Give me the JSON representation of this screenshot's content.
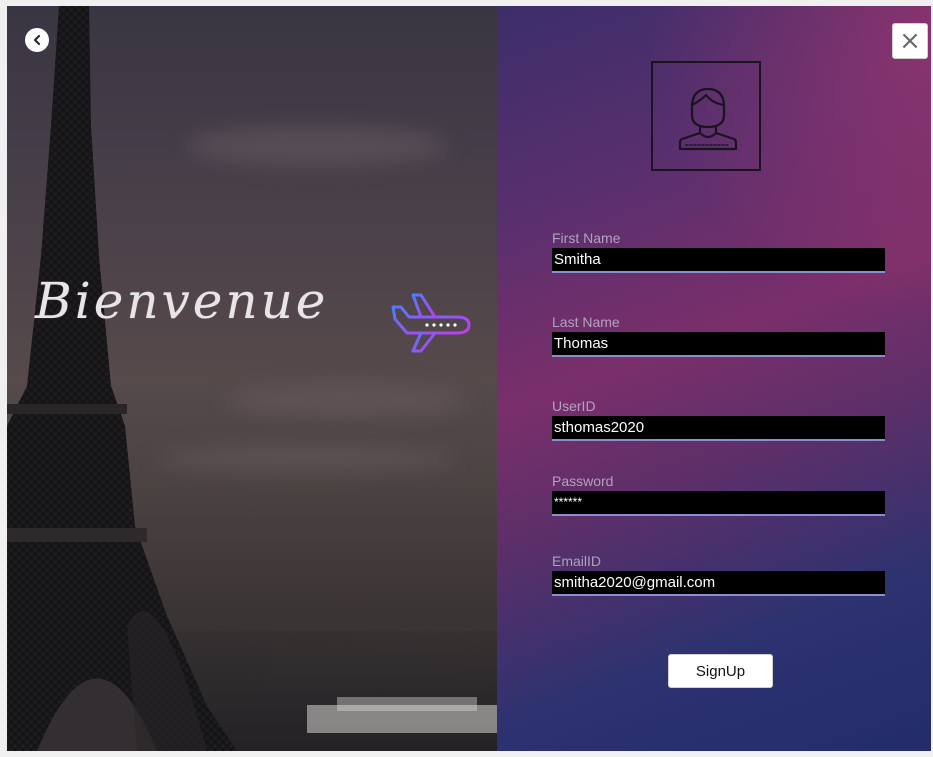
{
  "left_panel": {
    "welcome_text": "Bienvenue"
  },
  "icons": {
    "back": "chevron-left-icon",
    "close": "close-icon",
    "avatar": "user-avatar-icon",
    "plane": "airplane-icon"
  },
  "form": {
    "first_name": {
      "label": "First Name",
      "value": "Smitha"
    },
    "last_name": {
      "label": "Last Name",
      "value": "Thomas"
    },
    "user_id": {
      "label": "UserID",
      "value": "sthomas2020"
    },
    "password": {
      "label": "Password",
      "value": "******"
    },
    "email": {
      "label": "EmailID",
      "value": "smitha2020@gmail.com"
    },
    "submit_label": "SignUp"
  },
  "colors": {
    "accent_line": "#8a8fd0",
    "input_bg": "#000000",
    "plane_gradient_start": "#4f7cff",
    "plane_gradient_end": "#c13cf0"
  }
}
